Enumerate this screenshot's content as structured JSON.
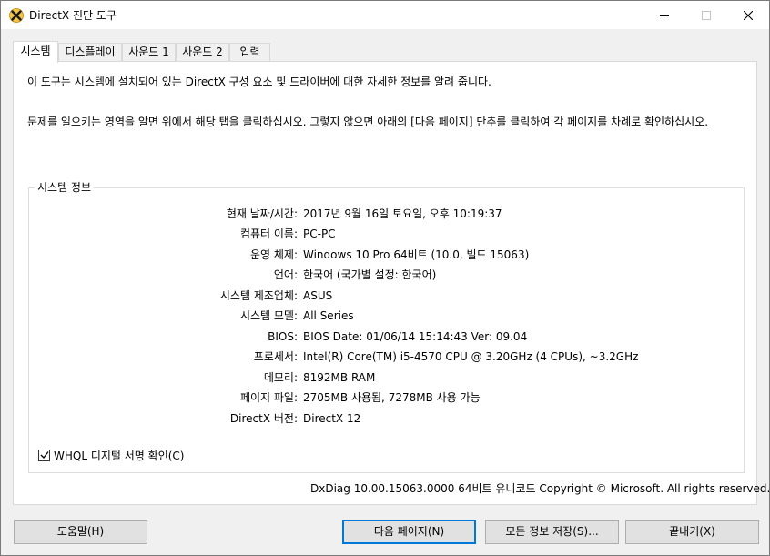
{
  "window": {
    "title": "DirectX 진단 도구"
  },
  "tabs": [
    {
      "label": "시스템",
      "active": true
    },
    {
      "label": "디스플레이",
      "active": false
    },
    {
      "label": "사운드 1",
      "active": false
    },
    {
      "label": "사운드 2",
      "active": false
    },
    {
      "label": "입력",
      "active": false
    }
  ],
  "intro": {
    "line1": "이 도구는 시스템에 설치되어 있는 DirectX 구성 요소 및 드라이버에 대한 자세한 정보를 알려 줍니다.",
    "line2": "문제를 일으키는 영역을 알면 위에서 해당 탭을 클릭하십시오. 그렇지 않으면 아래의 [다음 페이지] 단추를 클릭하여 각 페이지를 차례로 확인하십시오."
  },
  "system_info": {
    "group_title": "시스템 정보",
    "rows": [
      {
        "label": "현재 날짜/시간:",
        "value": "2017년 9월 16일 토요일, 오후 10:19:37"
      },
      {
        "label": "컴퓨터 이름:",
        "value": "PC-PC"
      },
      {
        "label": "운영 체제:",
        "value": "Windows 10 Pro 64비트 (10.0, 빌드 15063)"
      },
      {
        "label": "언어:",
        "value": "한국어 (국가별 설정: 한국어)"
      },
      {
        "label": "시스템 제조업체:",
        "value": "ASUS"
      },
      {
        "label": "시스템 모델:",
        "value": "All Series"
      },
      {
        "label": "BIOS:",
        "value": "BIOS Date: 01/06/14 15:14:43 Ver: 09.04"
      },
      {
        "label": "프로세서:",
        "value": "Intel(R) Core(TM) i5-4570 CPU @ 3.20GHz (4 CPUs), ~3.2GHz"
      },
      {
        "label": "메모리:",
        "value": "8192MB RAM"
      },
      {
        "label": "페이지 파일:",
        "value": "2705MB 사용됨, 7278MB 사용 가능"
      },
      {
        "label": "DirectX 버전:",
        "value": "DirectX 12"
      }
    ]
  },
  "whql": {
    "label": "WHQL 디지털 서명 확인(C)",
    "checked": true
  },
  "footer": {
    "text": "DxDiag 10.00.15063.0000 64비트 유니코드  Copyright © Microsoft. All rights reserved."
  },
  "buttons": {
    "help": "도움말(H)",
    "next": "다음 페이지(N)",
    "save": "모든 정보 저장(S)...",
    "exit": "끝내기(X)"
  },
  "colors": {
    "accent": "#0078d7",
    "window_bg": "#f0f0f0",
    "panel_bg": "#ffffff"
  }
}
